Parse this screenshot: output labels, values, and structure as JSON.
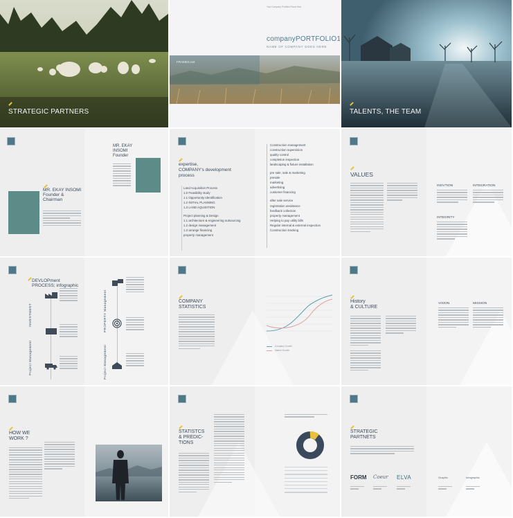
{
  "s1": {
    "title": "STRATEGIC PARTNERS"
  },
  "s2": {
    "brand": "companyPORTFOLIO17",
    "sub": "NAME OF COMPANY GOES HERE",
    "band": "FRAMES.net",
    "top": "Your Company Portfolio Fiscal Year"
  },
  "s3": {
    "title": "TALENTS, THE TEAM"
  },
  "s4": {
    "name_left": "MR. EKAY INSOMI",
    "role_left": "Founder & Chairman",
    "name_right_1": "MR. EKAY",
    "name_right_2": "INSOMI",
    "role_right": "Founder"
  },
  "s5": {
    "title_1": "expertise,",
    "title_2": "COMPANY's development",
    "title_3": "process",
    "left_list": [
      "Land Acquisition Process",
      "1.0  Feasibility study",
      "1.1  Opportunity Identification",
      "1.2  INITIAL PLANNING",
      "1.3  LAND AQUISITION",
      "Project planning & Design",
      "1.1  architecture & engineering outsourcing",
      "1.2  design management",
      "1.3  arrange financing",
      "property management"
    ],
    "right_list": [
      "Construction  management",
      "construction supervision",
      "quality control",
      "completion inspection",
      "landscaping & fixture installation",
      "pre sale, sale & marketing",
      "presale",
      "marketing",
      "advertising",
      "customer financing",
      "after sale service",
      "registration assistance",
      "feedback collection",
      "property management",
      "Helping to pay utility bills",
      "Regular internal & external inspection",
      "Construction tracking"
    ]
  },
  "s6": {
    "title": "VALUES",
    "h1": "INOVTION",
    "h2": "INTEGRATION",
    "h3": "INTEGRITY"
  },
  "s7": {
    "title_1": "DEVLOPment",
    "title_2": "PROCESS; infographic",
    "v1": "INVESTMENT",
    "v2": "Project Management",
    "v3": "PROPERTY Management",
    "v4": "Project Management"
  },
  "s8": {
    "title_1": "COMPANY",
    "title_2": "STATISTICS",
    "legend": [
      "Company Growth",
      "Market Growth"
    ]
  },
  "s9": {
    "title_1": "History",
    "title_2": "& CULTURE",
    "h1": "VISION",
    "h2": "MISSION"
  },
  "s10": {
    "title_1": "HOW WE",
    "title_2": "WORK ?"
  },
  "s11": {
    "title_1": "STATISTCS",
    "title_2": "& PREDIC-",
    "title_3": "TIONS"
  },
  "s12": {
    "title_1": "STRATEGIC",
    "title_2": "PARTNETS",
    "logos": [
      "FORM",
      "Coeur",
      "ELVA",
      "Graphic",
      "Infographic"
    ]
  },
  "colors": {
    "teal": "#5d8c88",
    "navy": "#3a4a5c",
    "accent": "#e8c23a",
    "logo": "#4e7887"
  }
}
